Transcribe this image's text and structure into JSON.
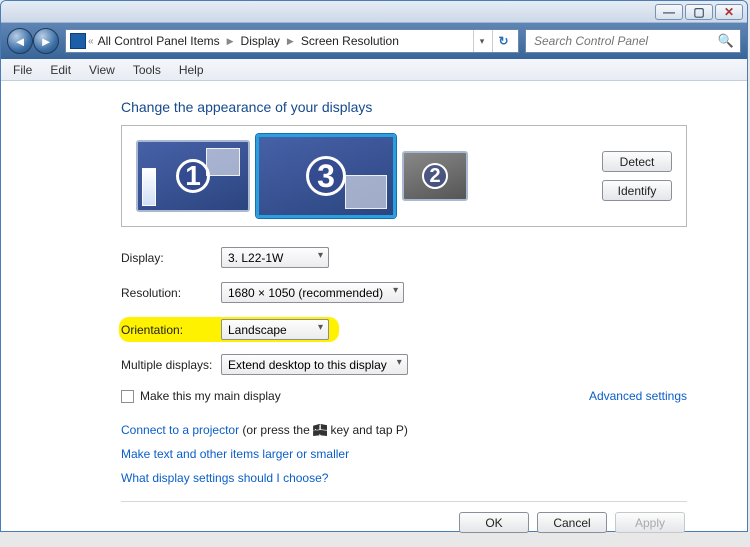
{
  "titlebar": {
    "left_small_1": "",
    "left_small_2": ""
  },
  "window_controls": {
    "minimize": "—",
    "maximize": "▢",
    "close": "✕"
  },
  "address": {
    "part1": "All Control Panel Items",
    "part2": "Display",
    "part3": "Screen Resolution"
  },
  "search": {
    "placeholder": "Search Control Panel"
  },
  "menu": {
    "file": "File",
    "edit": "Edit",
    "view": "View",
    "tools": "Tools",
    "help": "Help"
  },
  "heading": "Change the appearance of your displays",
  "monitors": {
    "m1_num": "1",
    "m2_num": "2",
    "m3_num": "3"
  },
  "panel_btn": {
    "detect": "Detect",
    "identify": "Identify"
  },
  "labels": {
    "display": "Display:",
    "resolution": "Resolution:",
    "orientation": "Orientation:",
    "multiple": "Multiple displays:"
  },
  "values": {
    "display": "3. L22-1W",
    "resolution": "1680 × 1050 (recommended)",
    "orientation": "Landscape",
    "multiple": "Extend desktop to this display"
  },
  "make_main": "Make this my main display",
  "advanced": "Advanced settings",
  "projector_prefix": "Connect to a projector",
  "projector_suffix_1": " (or press the ",
  "projector_suffix_2": " key and tap P)",
  "link_textsize": "Make text and other items larger or smaller",
  "link_choose": "What display settings should I choose?",
  "btn": {
    "ok": "OK",
    "cancel": "Cancel",
    "apply": "Apply"
  }
}
